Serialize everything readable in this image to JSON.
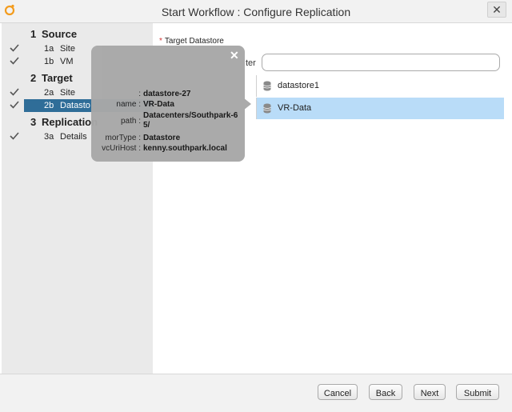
{
  "window": {
    "title": "Start Workflow : Configure Replication",
    "close_glyph": "✕"
  },
  "steps": {
    "source": {
      "num": "1",
      "label": "Source"
    },
    "source_site": {
      "num": "1a",
      "label": "Site"
    },
    "source_vm": {
      "num": "1b",
      "label": "VM"
    },
    "target": {
      "num": "2",
      "label": "Target"
    },
    "target_site": {
      "num": "2a",
      "label": "Site"
    },
    "target_datastore": {
      "num": "2b",
      "label": "Datasto"
    },
    "replication": {
      "num": "3",
      "label": "Replication"
    },
    "replication_details": {
      "num": "3a",
      "label": "Details"
    }
  },
  "form": {
    "required_mark": "*",
    "target_datastore_label": "Target Datastore",
    "filter_label": "ter",
    "filter_value": ""
  },
  "datastores": [
    {
      "name": "datastore1",
      "selected": false
    },
    {
      "name": "VR-Data",
      "selected": true
    }
  ],
  "tooltip": {
    "close_glyph": "✕",
    "id_key": ":",
    "id_value": "datastore-27",
    "name_key": "name :",
    "name_value": "VR-Data",
    "path_key": "path :",
    "path_value": "Datacenters/Southpark-65/",
    "morType_key": "morType :",
    "morType_value": "Datastore",
    "vcUriHost_key": "vcUriHost :",
    "vcUriHost_value": "kenny.southpark.local"
  },
  "buttons": {
    "cancel": "Cancel",
    "back": "Back",
    "next": "Next",
    "submit": "Submit"
  },
  "colors": {
    "selected_step": "#2f6d98",
    "selected_row": "#b9dcf8",
    "logo": "#f39c1e"
  }
}
